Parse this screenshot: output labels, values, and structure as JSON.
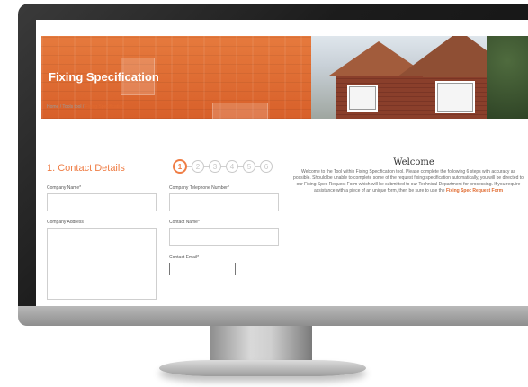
{
  "header": {
    "title": "Fixing Specification"
  },
  "breadcrumb": {
    "home": "Home",
    "sep1": " / ",
    "tools": "Tools tool",
    "sep2": " / ",
    "current": "Fixing Specification"
  },
  "section": {
    "title": "1. Contact Details"
  },
  "steps": [
    {
      "label": "1",
      "active": true
    },
    {
      "label": "2",
      "active": false
    },
    {
      "label": "3",
      "active": false
    },
    {
      "label": "4",
      "active": false
    },
    {
      "label": "5",
      "active": false
    },
    {
      "label": "6",
      "active": false
    }
  ],
  "form": {
    "company_name_label": "Company Name*",
    "company_phone_label": "Company Telephone Number*",
    "company_address_label": "Company Address",
    "contact_name_label": "Contact Name*",
    "contact_email_label": "Contact Email*"
  },
  "welcome": {
    "title": "Welcome",
    "text": "Welcome to the Tool within Fixing Specification tool. Please complete the following 6 steps with accuracy as possible. Should be unable to complete some of the request fixing specification automatically, you will be directed to our Fixing Spec Request Form which will be submitted to our Technical Department for processing. If you require assistance with a piece of an unique form, then be sure to use the ",
    "link": "Fixing Spec Request Form"
  },
  "colors": {
    "accent": "#ef7d45",
    "header_orange": "#e06a2f"
  }
}
